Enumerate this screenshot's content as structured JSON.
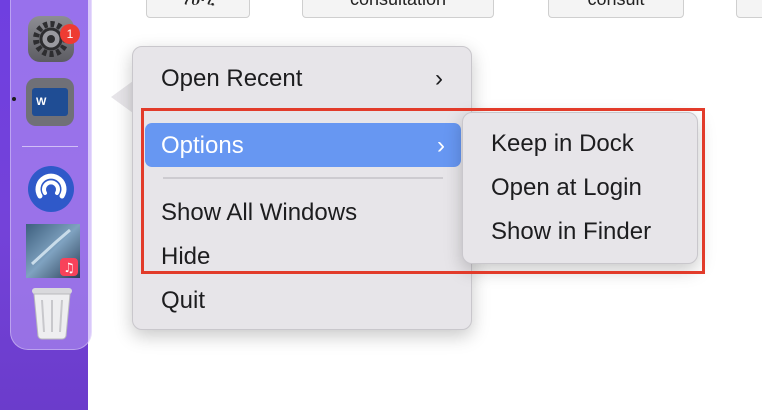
{
  "toolbar_buttons": [
    {
      "label": "ሃሁሂ"
    },
    {
      "label": "consultation"
    },
    {
      "label": "consult"
    },
    {
      "label": ""
    }
  ],
  "dock": {
    "settings_badge": "1",
    "word_letter": "W"
  },
  "context_menu": {
    "open_recent": "Open Recent",
    "options": "Options",
    "show_all_windows": "Show All Windows",
    "hide": "Hide",
    "quit": "Quit",
    "chevron": "›"
  },
  "options_submenu": {
    "items": [
      "Keep in Dock",
      "Open at Login",
      "Show in Finder"
    ]
  },
  "colors": {
    "highlight": "#6797f2",
    "annotation_box": "#e23b2a",
    "badge": "#ee3b32"
  }
}
